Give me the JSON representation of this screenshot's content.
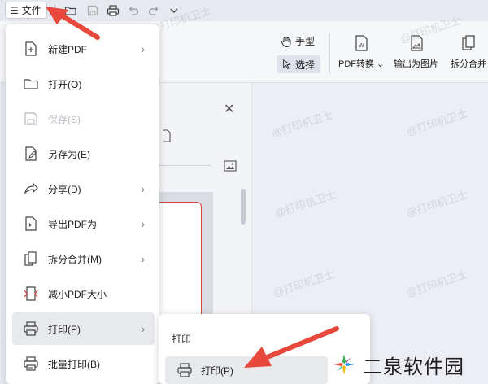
{
  "topbar": {
    "file_menu_label": "文件",
    "menu_glyph": "☰"
  },
  "ribbon": {
    "hand_label": "手型",
    "select_label": "选择",
    "pdf_convert_label": "PDF转换",
    "export_image_label": "输出为图片",
    "split_merge_label": "拆分合并"
  },
  "file_menu": {
    "items": [
      {
        "label": "新建PDF",
        "icon": "new-pdf-icon",
        "has_submenu": true
      },
      {
        "label": "打开(O)",
        "icon": "folder-open-icon",
        "has_submenu": false
      },
      {
        "label": "保存(S)",
        "icon": "save-icon",
        "has_submenu": false,
        "disabled": true
      },
      {
        "label": "另存为(E)",
        "icon": "save-as-icon",
        "has_submenu": false
      },
      {
        "label": "分享(D)",
        "icon": "share-icon",
        "has_submenu": true
      },
      {
        "label": "导出PDF为",
        "icon": "export-pdf-icon",
        "has_submenu": true
      },
      {
        "label": "拆分合并(M)",
        "icon": "split-merge-icon",
        "has_submenu": true
      },
      {
        "label": "减小PDF大小",
        "icon": "compress-pdf-icon",
        "has_submenu": false
      },
      {
        "label": "打印(P)",
        "icon": "printer-icon",
        "has_submenu": true,
        "active": true
      },
      {
        "label": "批量打印(B)",
        "icon": "batch-print-icon",
        "has_submenu": false
      }
    ]
  },
  "print_submenu": {
    "title": "打印",
    "item_label": "打印(P)"
  },
  "watermark_text": "@打印机卫士",
  "brand": {
    "name": "二泉软件园"
  },
  "colors": {
    "arrow_red": "#e8473b",
    "thumb_border": "#d9473a"
  }
}
